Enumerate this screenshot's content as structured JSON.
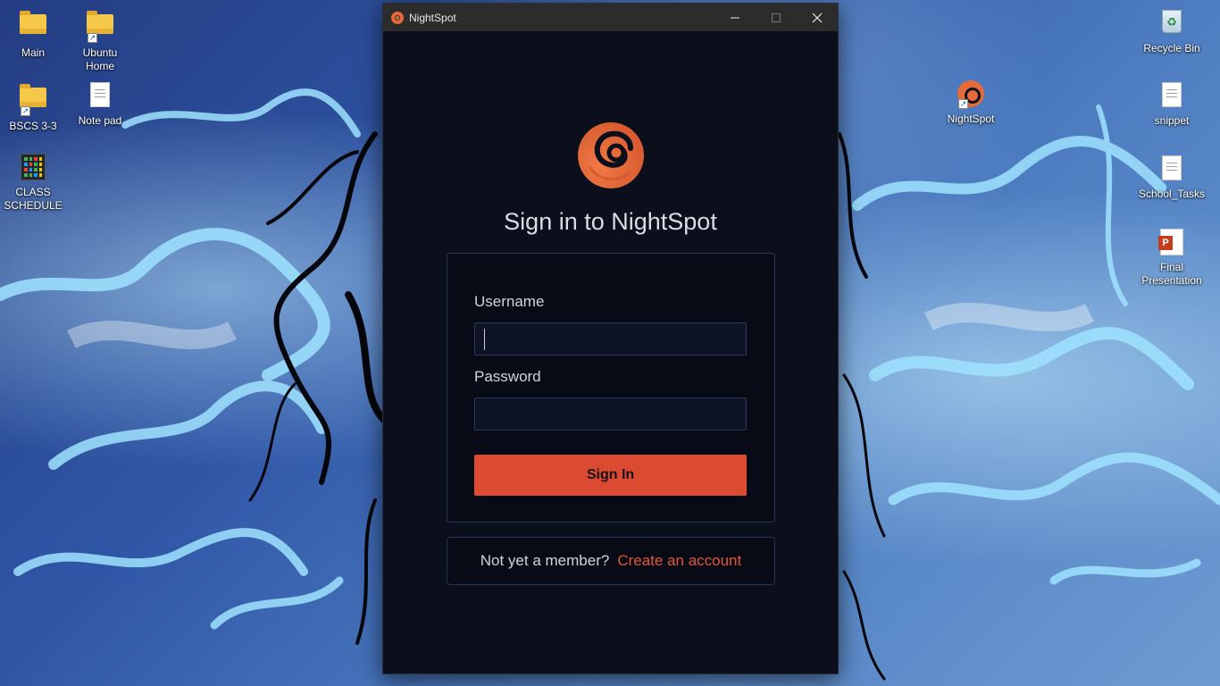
{
  "desktop": {
    "icons_left": [
      {
        "label": "Main",
        "icon": "folder-icon"
      },
      {
        "label": "Ubuntu Home",
        "icon": "folder-shortcut-icon"
      },
      {
        "label": "BSCS 3-3",
        "icon": "folder-shortcut-icon"
      },
      {
        "label": "Note pad",
        "icon": "text-document-icon"
      },
      {
        "label": "CLASS SCHEDULE",
        "icon": "schedule-icon"
      }
    ],
    "icons_right": [
      {
        "label": "NightSpot",
        "icon": "nightspot-app-icon"
      },
      {
        "label": "Recycle Bin",
        "icon": "recycle-bin-icon"
      },
      {
        "label": "snippet",
        "icon": "text-document-icon"
      },
      {
        "label": "School_Tasks",
        "icon": "text-document-icon"
      },
      {
        "label": "Final Presentation",
        "icon": "powerpoint-icon"
      }
    ],
    "shortcut_arrow": "↗",
    "recycle_glyph": "♻",
    "ppt_letter": "P"
  },
  "window": {
    "title": "NightSpot",
    "accent_color": "#e56a3a",
    "controls": [
      "minimize",
      "maximize",
      "close"
    ]
  },
  "login": {
    "heading": "Sign in to NightSpot",
    "username_label": "Username",
    "username_value": "",
    "password_label": "Password",
    "password_value": "",
    "signin_label": "Sign In",
    "signin_color": "#dd4a32",
    "prompt_text": "Not yet a member?",
    "create_account_label": "Create an account",
    "link_color": "#e2553a"
  }
}
